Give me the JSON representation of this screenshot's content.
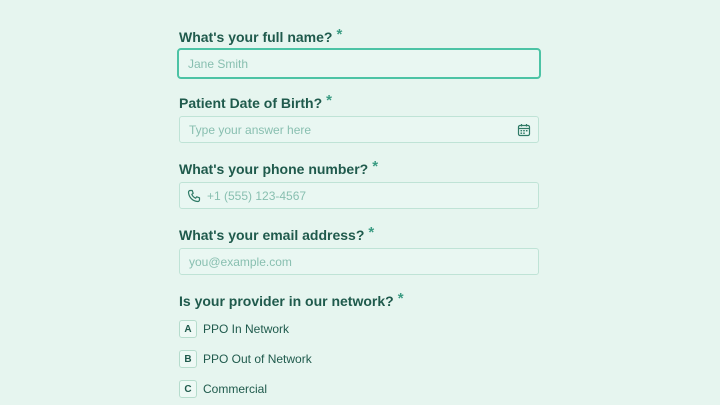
{
  "form": {
    "required_marker": "*",
    "name": {
      "label": "What's your full name?",
      "placeholder": "Jane Smith",
      "value": ""
    },
    "dob": {
      "label": "Patient Date of Birth?",
      "placeholder": "Type your answer here",
      "value": "",
      "icon": "calendar-icon"
    },
    "phone": {
      "label": "What's your phone number?",
      "placeholder": "+1 (555) 123-4567",
      "value": "",
      "icon": "phone-icon"
    },
    "email": {
      "label": "What's your email address?",
      "placeholder": "you@example.com",
      "value": ""
    },
    "provider": {
      "label": "Is your provider in our network?",
      "options": [
        {
          "key": "A",
          "label": "PPO In Network"
        },
        {
          "key": "B",
          "label": "PPO Out of Network"
        },
        {
          "key": "C",
          "label": "Commercial"
        }
      ]
    }
  },
  "colors": {
    "background": "#e6f5ef",
    "text": "#1f5a4c",
    "accent": "#4cc3a5",
    "border": "#bfe3d6"
  }
}
